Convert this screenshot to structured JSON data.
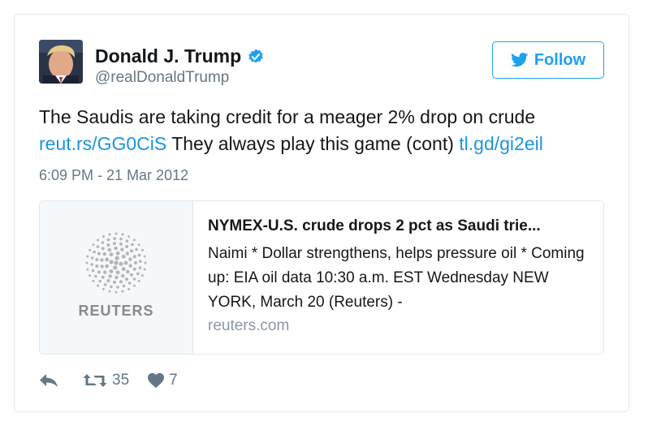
{
  "user": {
    "name": "Donald J. Trump",
    "handle": "@realDonaldTrump",
    "verified": true,
    "avatar": "avatar-photo"
  },
  "follow_button": {
    "label": "Follow",
    "icon": "twitter-bird-icon"
  },
  "tweet": {
    "text_part1": "The Saudis are taking credit for a meager 2% drop on crude",
    "link1": "reut.rs/GG0CiS",
    "text_part2": " They always play this game (cont) ",
    "link2": "tl.gd/gi2eil",
    "timestamp": "6:09 PM - 21 Mar 2012"
  },
  "card": {
    "logo_text": "REUTERS",
    "title": "NYMEX-U.S. crude drops 2 pct as Saudi trie...",
    "description": "Naimi * Dollar strengthens, helps pressure oil * Coming up: EIA oil data 10:30 a.m. EST Wednesday NEW YORK, March 20 (Reuters) -",
    "domain": "reuters.com"
  },
  "actions": {
    "reply_icon": "reply-icon",
    "retweet_icon": "retweet-icon",
    "retweet_count": "35",
    "like_icon": "heart-icon",
    "like_count": "7"
  },
  "colors": {
    "accent": "#1da1f2",
    "link": "#1b95e0",
    "text": "#14171a",
    "muted": "#657786",
    "border": "#e1e8ed"
  }
}
